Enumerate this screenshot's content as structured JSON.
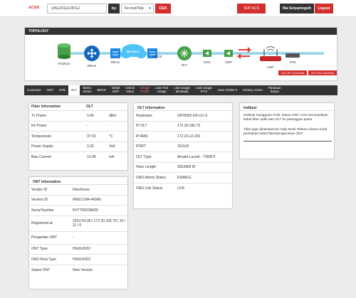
{
  "header": {
    "logo": "ACSIS",
    "search_value": "161201223012",
    "by_label": "by",
    "select_value": "No Inet/Telp",
    "check_label": "CEK",
    "sop_label": "SOP ACS",
    "user_name": "Nia Setyaningsih",
    "logout_label": "Logout",
    "brand_color": "#d32f2f"
  },
  "topology": {
    "title": "TOPOLOGY",
    "nodes": [
      "RADIUS",
      "BRAS",
      "BRAS",
      "METRO-E",
      "AGGS",
      "OLT",
      "ODC",
      "ODP",
      "ONT",
      "STB"
    ],
    "status_badges": [
      "ACS-ONT Connectivity",
      "ACS-STB Connectivity"
    ]
  },
  "tabs": [
    {
      "label": "Customer",
      "active": false
    },
    {
      "label": "ONT",
      "active": false
    },
    {
      "label": "STB",
      "active": false
    },
    {
      "label": "OLT",
      "active": true
    },
    {
      "label": "Metro\nAkses",
      "active": false
    },
    {
      "label": "BRAS",
      "active": false
    },
    {
      "label": "Detail\nODP",
      "active": false
    },
    {
      "label": "Check\nVoice",
      "active": false
    },
    {
      "label": "Usage\nPCRF",
      "active": false,
      "highlight": true
    },
    {
      "label": "Last Five\nUsage",
      "active": false
    },
    {
      "label": "Last Usage\nMinikada",
      "active": false
    },
    {
      "label": "Last Usage\nIPTV",
      "active": false
    },
    {
      "label": "User Online  ▾",
      "active": false
    },
    {
      "label": "History Action",
      "active": false
    },
    {
      "label": "Panduan\nSolusi",
      "active": false
    }
  ],
  "fiber": {
    "title": "Fiber Information",
    "col": "OLT",
    "rows": [
      {
        "k": "Tx Power",
        "v": "3.46",
        "u": "dBm"
      },
      {
        "k": "Rx Power",
        "v": "-",
        "u": "-"
      },
      {
        "k": "Temperature",
        "v": "37.53",
        "u": "°C"
      },
      {
        "k": "Power Supply",
        "v": "3.26",
        "u": "Volt"
      },
      {
        "k": "Bias Current",
        "v": "12.48",
        "u": "mA"
      }
    ]
  },
  "ont": {
    "title": "ONT Information",
    "rows": [
      {
        "k": "Vendor ID",
        "v": "Fiberhome"
      },
      {
        "k": "Version ID",
        "v": "WKE2.094.443A0"
      },
      {
        "k": "Serial Number",
        "v": "FHTT9D228430"
      },
      {
        "k": "Registered at",
        "v": "2023-02-06 | 172.20.166.79 | 15 / 11 / 6"
      },
      {
        "k": "Pergantian ONT",
        "v": "-"
      },
      {
        "k": "ONT Type",
        "v": "HG6145D2"
      },
      {
        "k": "ONU Real Type",
        "v": "HG6145D2"
      },
      {
        "k": "Status ONT",
        "v": "New Version"
      }
    ]
  },
  "olt": {
    "title": "OLT Information",
    "rows": [
      {
        "k": "Hostname",
        "v": "GPON02-D6-ULI-5"
      },
      {
        "k": "IP OLT",
        "v": "172.20.166.79"
      },
      {
        "k": "IP AMS",
        "v": "172.24.12.100"
      },
      {
        "k": "PORT",
        "v": "15/11/6"
      },
      {
        "k": "OLT Type",
        "v": "Alcatel-Lucent - 7360FX"
      },
      {
        "k": "Fiber Length",
        "v": "6553400 M"
      },
      {
        "k": "ONU Admin Status",
        "v": "ENABLE"
      },
      {
        "k": "ONU Link Status",
        "v": "LOS"
      }
    ]
  },
  "indikasi": {
    "title": "Indikasi",
    "text1": "Indikasi Gangguan Fisik: status ONT LOS menunjukkan kabel fiber optik dari OLT ke pelanggan putus",
    "text2": "Tiket agar dieskalasi ke Help Desk Telkom Akses untuk perbaikan kabel fiber/pengecekan ONT"
  }
}
